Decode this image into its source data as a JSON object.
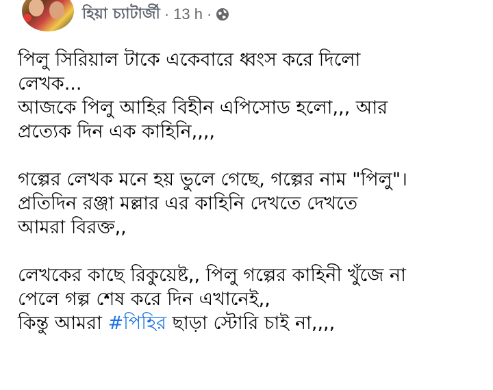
{
  "post": {
    "author": "হিয়া চ্যাটার্জী",
    "separator1": "·",
    "time": "13 h",
    "separator2": "·",
    "privacy_icon": "globe-icon",
    "paragraphs": [
      {
        "lines": [
          "পিলু সিরিয়াল টাকে একেবারে ধ্বংস করে দিলো",
          "লেখক...",
          "আজকে পিলু আহির বিহীন এপিসোড হলো,,,  আর",
          "প্রত্যেক দিন এক কাহিনি,,,,"
        ]
      },
      {
        "lines": [
          "গল্পের লেখক মনে হয় ভুলে গেছে, গল্পের নাম \"পিলু\"।",
          "প্রতিদিন রঞ্জা মল্লার এর কাহিনি দেখতে দেখতে",
          "আমরা বিরক্ত,,"
        ]
      },
      {
        "lines": [
          "লেখকের কাছে রিকুয়েষ্ট,,  পিলু গল্পের কাহিনী খুঁজে না",
          "পেলে গল্প শেষ করে দিন এখানেই,,"
        ],
        "last_line": {
          "before": "কিন্তু আমরা ",
          "hashtag": "#পিহির",
          "after": " ছাড়া স্টোরি চাই না,,,,"
        }
      }
    ]
  },
  "colors": {
    "text": "#050505",
    "meta": "#65676b",
    "hashtag": "#1b74e4",
    "background": "#ffffff"
  }
}
